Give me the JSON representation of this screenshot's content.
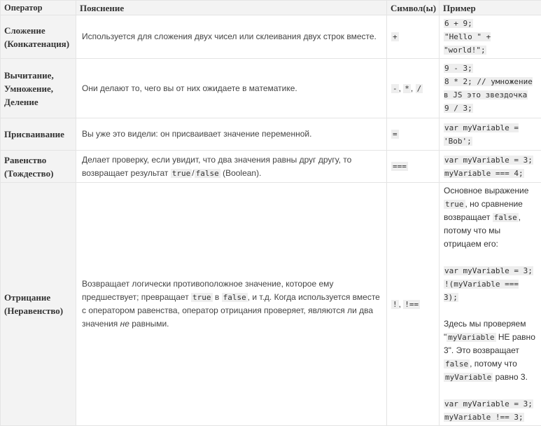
{
  "headers": {
    "operator": "Оператор",
    "explanation": "Пояснение",
    "symbols": "Символ(ы)",
    "example": "Пример"
  },
  "rows": [
    {
      "name": "Сложение (Конкатенация)",
      "desc": "Используется для сложения двух чисел или склеивания двух строк вместе.",
      "symbols": [
        "+"
      ],
      "code": [
        "6 + 9;",
        "\"Hello \" + \"world!\";"
      ]
    },
    {
      "name_lines": [
        "Вычитание,",
        "Умножение,",
        "Деление"
      ],
      "desc": "Они делают то, чего вы от них ожидаете в математике.",
      "symbols": [
        "-",
        "*",
        "/"
      ],
      "code": [
        "9 - 3;",
        "8 * 2; // умножение в JS это звездочка",
        "9 / 3;"
      ]
    },
    {
      "name": "Присваивание",
      "desc": "Вы уже это видели: он присваивает значение переменной.",
      "symbols": [
        "="
      ],
      "code": [
        "var myVariable = 'Bob';"
      ]
    },
    {
      "name": "Равенство (Тождество)",
      "desc_parts": [
        "Делает проверку, если увидит, что два значения равны друг другу, то возвращает результат ",
        "true",
        "/",
        "false",
        " (Boolean)."
      ],
      "symbols": [
        "==="
      ],
      "code": [
        "var myVariable = 3;",
        "myVariable === 4;"
      ]
    },
    {
      "name": "Отрицание (Неравенство)",
      "desc_parts": [
        "Возвращает логически противоположное значение, которое ему предшествует; превращает ",
        "true",
        " в ",
        "false",
        ", и т.д. Когда используется вместе с оператором равенства, оператор отрицания проверяет, являются ли два значения ",
        "не",
        " равными."
      ],
      "symbols": [
        "!",
        "!=="
      ],
      "example_parts": {
        "p1_a": "Основное выражение ",
        "p1_code1": "true",
        "p1_b": ", но сравнение возвращает ",
        "p1_code2": "false",
        "p1_c": ", потому что мы отрицаем его:",
        "code1": [
          "var myVariable = 3;",
          "!(myVariable === 3);"
        ],
        "p2_a": "Здесь мы проверяем \"",
        "p2_code1": "myVariable",
        "p2_b": " НЕ равно 3\". Это возвращает ",
        "p2_code2": "false",
        "p2_c": ", потому что ",
        "p2_code3": "myVariable",
        "p2_d": " равно 3.",
        "code2": [
          "var myVariable = 3;",
          "myVariable !== 3;"
        ]
      }
    }
  ],
  "separator": ", "
}
